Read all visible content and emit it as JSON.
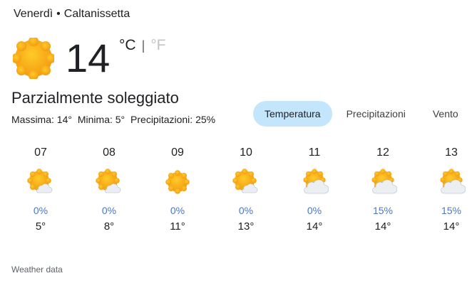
{
  "header": {
    "day": "Venerdì",
    "separator": "•",
    "location": "Caltanissetta"
  },
  "current": {
    "temperature": "14",
    "unit_c": "°C",
    "unit_sep": "|",
    "unit_f": "°F",
    "icon": "sun-icon",
    "condition": "Parzialmente soleggiato",
    "max": "Massima: 14°",
    "min": "Minima: 5°",
    "precip": "Precipitazioni: 25%"
  },
  "tabs": [
    {
      "label": "Temperatura",
      "active": true
    },
    {
      "label": "Precipitazioni",
      "active": false
    },
    {
      "label": "Vento",
      "active": false
    }
  ],
  "hourly": [
    {
      "time": "07",
      "icon": "sun-cloud-small-icon",
      "precip": "0%",
      "temp": "5°"
    },
    {
      "time": "08",
      "icon": "sun-cloud-small-icon",
      "precip": "0%",
      "temp": "8°"
    },
    {
      "time": "09",
      "icon": "sun-icon",
      "precip": "0%",
      "temp": "11°"
    },
    {
      "time": "10",
      "icon": "sun-cloud-small-icon",
      "precip": "0%",
      "temp": "13°"
    },
    {
      "time": "11",
      "icon": "sun-cloud-icon",
      "precip": "0%",
      "temp": "14°"
    },
    {
      "time": "12",
      "icon": "sun-cloud-icon",
      "precip": "15%",
      "temp": "14°"
    },
    {
      "time": "13",
      "icon": "sun-cloud-icon",
      "precip": "15%",
      "temp": "14°"
    }
  ],
  "footer": {
    "label": "Weather data"
  },
  "colors": {
    "sun": "#F9A825",
    "sun_edge": "#F57C00",
    "cloud": "#ECEFF1",
    "precip": "#4A78C0",
    "active_tab": "#C3E6FC"
  }
}
